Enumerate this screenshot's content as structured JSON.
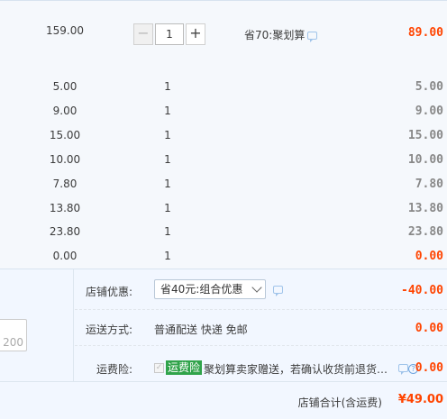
{
  "main_item": {
    "price": "159.00",
    "quantity": "1",
    "minus_label": "−",
    "plus_label": "+",
    "promo": "省70:聚划算",
    "subtotal": "89.00"
  },
  "sub_items": [
    {
      "price": "5.00",
      "qty": "1",
      "sum": "5.00"
    },
    {
      "price": "9.00",
      "qty": "1",
      "sum": "9.00"
    },
    {
      "price": "15.00",
      "qty": "1",
      "sum": "15.00"
    },
    {
      "price": "10.00",
      "qty": "1",
      "sum": "10.00"
    },
    {
      "price": "7.80",
      "qty": "1",
      "sum": "7.80"
    },
    {
      "price": "13.80",
      "qty": "1",
      "sum": "13.80"
    },
    {
      "price": "23.80",
      "qty": "1",
      "sum": "23.80"
    },
    {
      "price": "0.00",
      "qty": "1",
      "sum": "0.00"
    }
  ],
  "note": {
    "counter": "200"
  },
  "discount": {
    "label": "店铺优惠:",
    "selected": "省40元:组合优惠",
    "value": "-40.00"
  },
  "shipping": {
    "label": "运送方式:",
    "method": "普通配送 快递 免邮",
    "value": "0.00"
  },
  "insurance": {
    "label": "运费险:",
    "tag": "运费险",
    "text": "聚划算卖家赠送，若确认收货前退货…",
    "help": "?",
    "value": "0.00"
  },
  "store_total": {
    "label": "店铺合计(含运费)",
    "value": "¥49.00"
  },
  "colors": {
    "accent_red": "#ff4400",
    "insure_green": "#30a34a",
    "panel_bg": "#f2f7ff"
  }
}
